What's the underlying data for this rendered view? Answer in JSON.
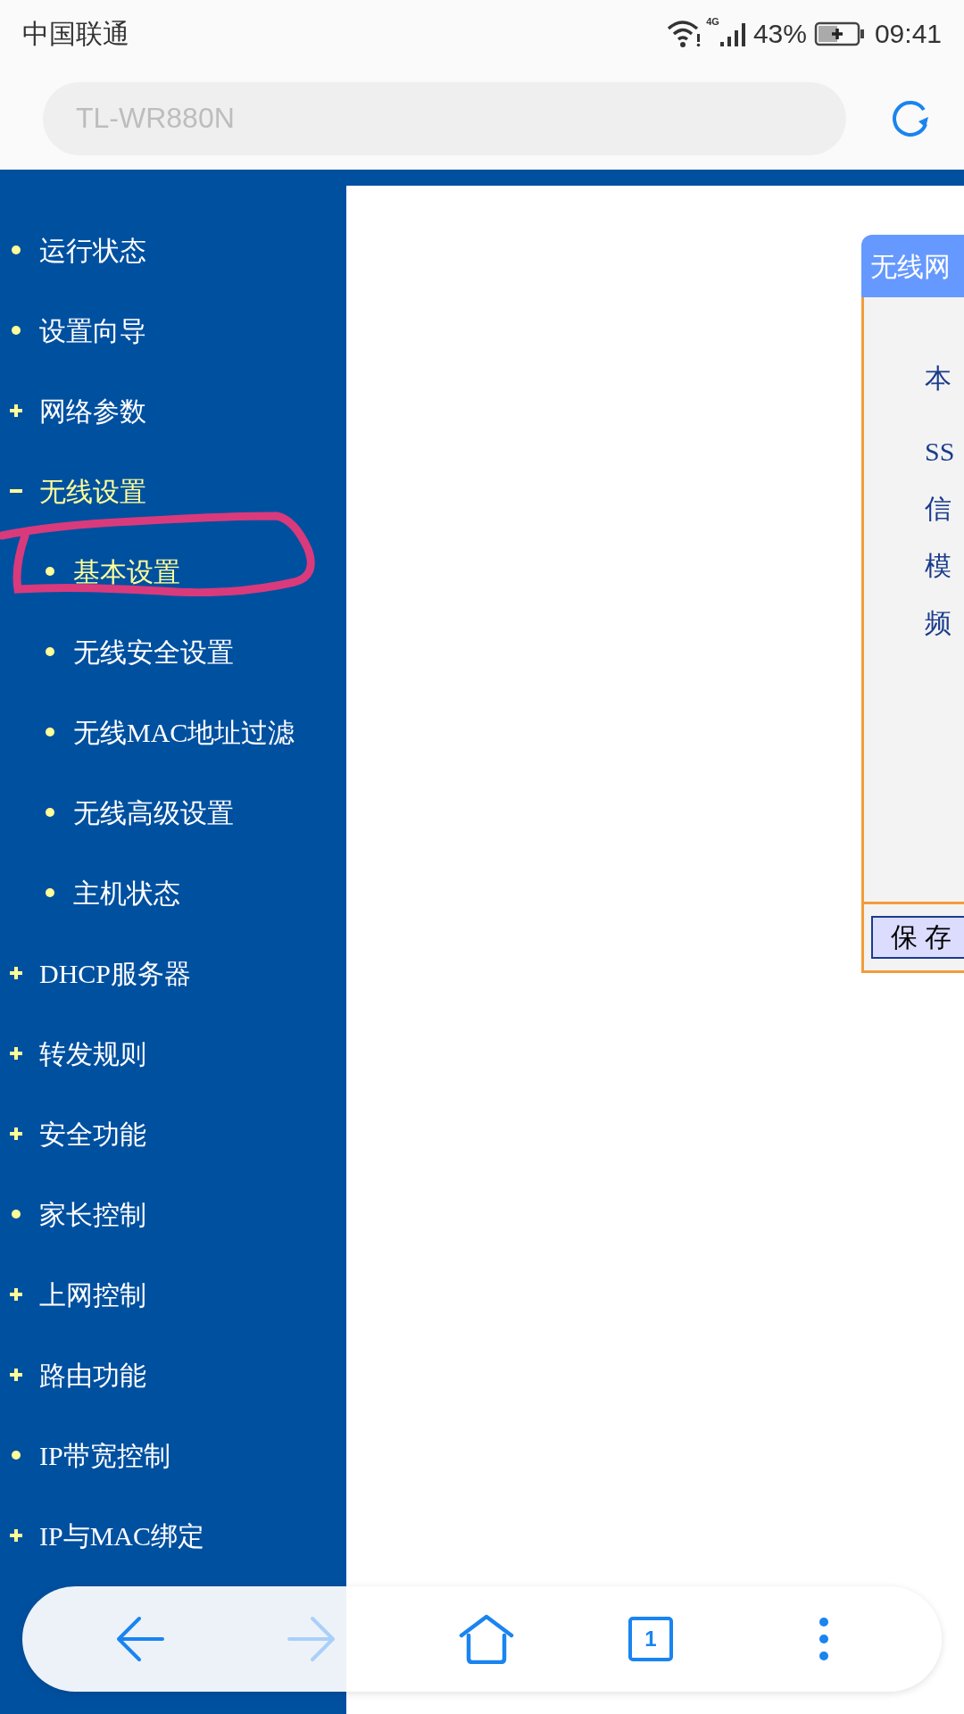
{
  "status_bar": {
    "carrier": "中国联通",
    "network": "4G",
    "battery": "43%",
    "time": "09:41"
  },
  "address_bar": {
    "placeholder": "TL-WR880N"
  },
  "sidebar": {
    "items": [
      {
        "label": "运行状态",
        "kind": "leaf",
        "selected": false
      },
      {
        "label": "设置向导",
        "kind": "leaf",
        "selected": false
      },
      {
        "label": "网络参数",
        "kind": "group",
        "expanded": false
      },
      {
        "label": "无线设置",
        "kind": "group",
        "expanded": true,
        "children": [
          {
            "label": "基本设置",
            "kind": "leaf",
            "selected": true
          },
          {
            "label": "无线安全设置",
            "kind": "leaf",
            "selected": false
          },
          {
            "label": "无线MAC地址过滤",
            "kind": "leaf",
            "selected": false
          },
          {
            "label": "无线高级设置",
            "kind": "leaf",
            "selected": false
          },
          {
            "label": "主机状态",
            "kind": "leaf",
            "selected": false
          }
        ]
      },
      {
        "label": "DHCP服务器",
        "kind": "group",
        "expanded": false
      },
      {
        "label": "转发规则",
        "kind": "group",
        "expanded": false
      },
      {
        "label": "安全功能",
        "kind": "group",
        "expanded": false
      },
      {
        "label": "家长控制",
        "kind": "leaf",
        "selected": false
      },
      {
        "label": "上网控制",
        "kind": "group",
        "expanded": false
      },
      {
        "label": "路由功能",
        "kind": "group",
        "expanded": false
      },
      {
        "label": "IP带宽控制",
        "kind": "leaf",
        "selected": false
      },
      {
        "label": "IP与MAC绑定",
        "kind": "group",
        "expanded": false
      }
    ]
  },
  "panel": {
    "title": "无线网",
    "lines": [
      "本",
      "SS",
      "信",
      "模",
      "频"
    ],
    "save_button": "保 存"
  },
  "bottom_nav": {
    "tab_count": "1"
  }
}
